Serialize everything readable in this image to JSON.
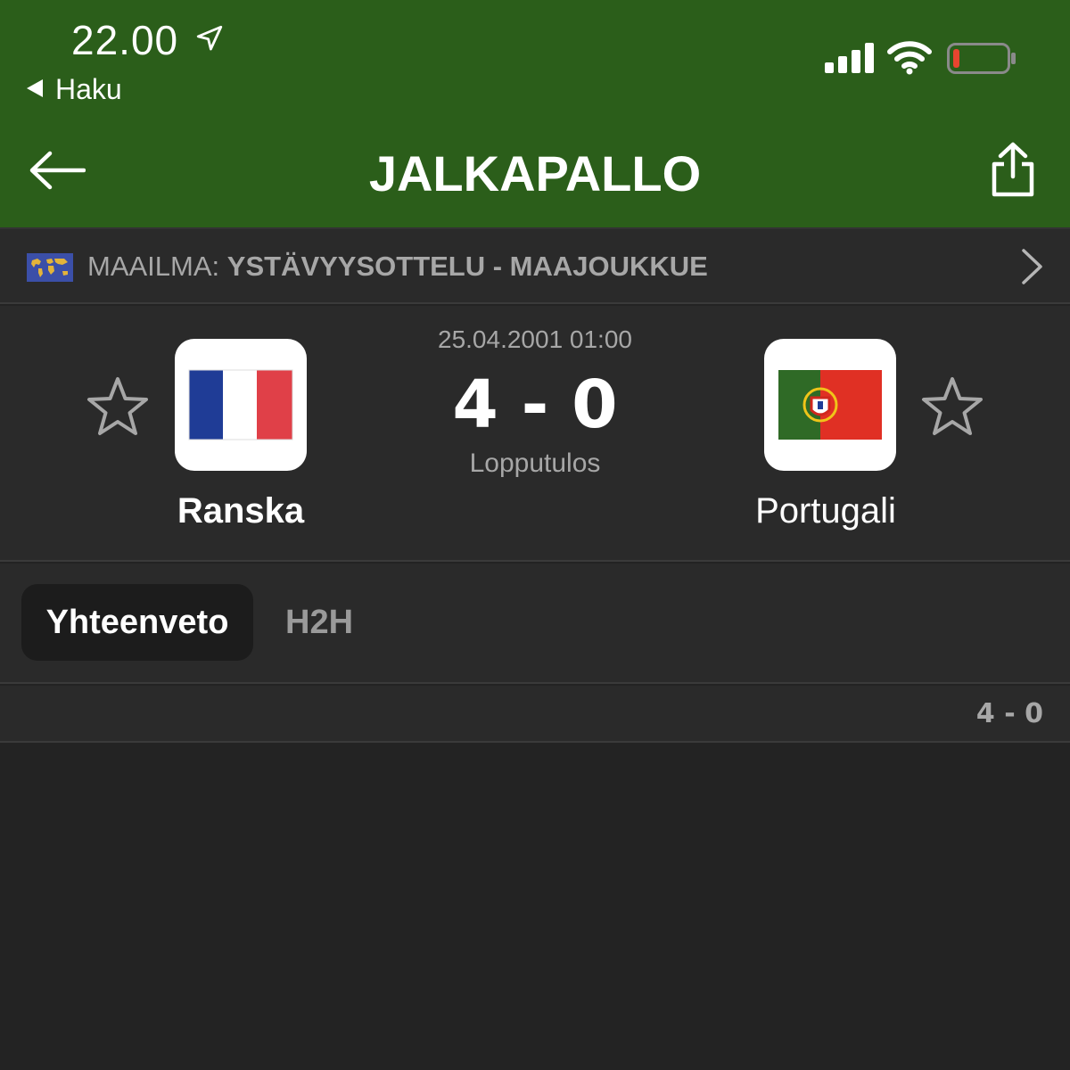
{
  "status_bar": {
    "time": "22.00",
    "back_app": "Haku",
    "icons": [
      "location-arrow-icon",
      "signal-icon",
      "wifi-icon",
      "battery-low-icon"
    ]
  },
  "nav": {
    "title": "JALKAPALLO",
    "back_icon": "arrow-left-icon",
    "share_icon": "share-icon"
  },
  "competition": {
    "region": "MAAILMA: ",
    "name": "YSTÄVYYSOTTELU - MAAJOUKKUE",
    "flag_icon": "world-flag-icon"
  },
  "match": {
    "date": "25.04.2001 01:00",
    "score": "4 - 0",
    "status": "Lopputulos",
    "home": {
      "name": "Ranska",
      "flag": "france-flag"
    },
    "away": {
      "name": "Portugali",
      "flag": "portugal-flag"
    }
  },
  "tabs": [
    {
      "label": "Yhteenveto",
      "active": true
    },
    {
      "label": "H2H",
      "active": false
    }
  ],
  "summary": {
    "result": "4 - 0"
  },
  "colors": {
    "header_bg": "#2b5e1a",
    "panel_bg": "#2a2a2a",
    "page_bg": "#232323",
    "muted_text": "#a7a7a7",
    "battery_low": "#e8452f"
  }
}
